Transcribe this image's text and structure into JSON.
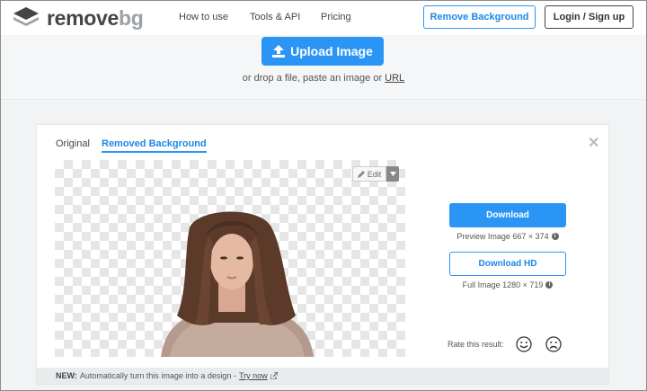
{
  "header": {
    "logo": {
      "word1": "remove",
      "word2": "bg"
    },
    "nav": [
      "How to use",
      "Tools & API",
      "Pricing"
    ],
    "remove_bg_label": "Remove Background",
    "login_label": "Login / Sign up"
  },
  "upload": {
    "button_label": "Upload Image",
    "drop_text": "or drop a file, paste an image or",
    "url_link": "URL"
  },
  "result": {
    "tabs": [
      "Original",
      "Removed Background"
    ],
    "active_tab": "Removed Background",
    "close_symbol": "✕",
    "edit_label": "Edit",
    "download_label": "Download",
    "preview_info": "Preview Image 667 × 374",
    "download_hd_label": "Download HD",
    "full_info": "Full Image 1280 × 719",
    "rate_label": "Rate this result:",
    "banner_new": "NEW:",
    "banner_text": "Automatically turn this image into a design -",
    "banner_link": "Try now"
  },
  "colors": {
    "accent": "#2b95f5",
    "link": "#1d86e8",
    "text": "#454545"
  }
}
